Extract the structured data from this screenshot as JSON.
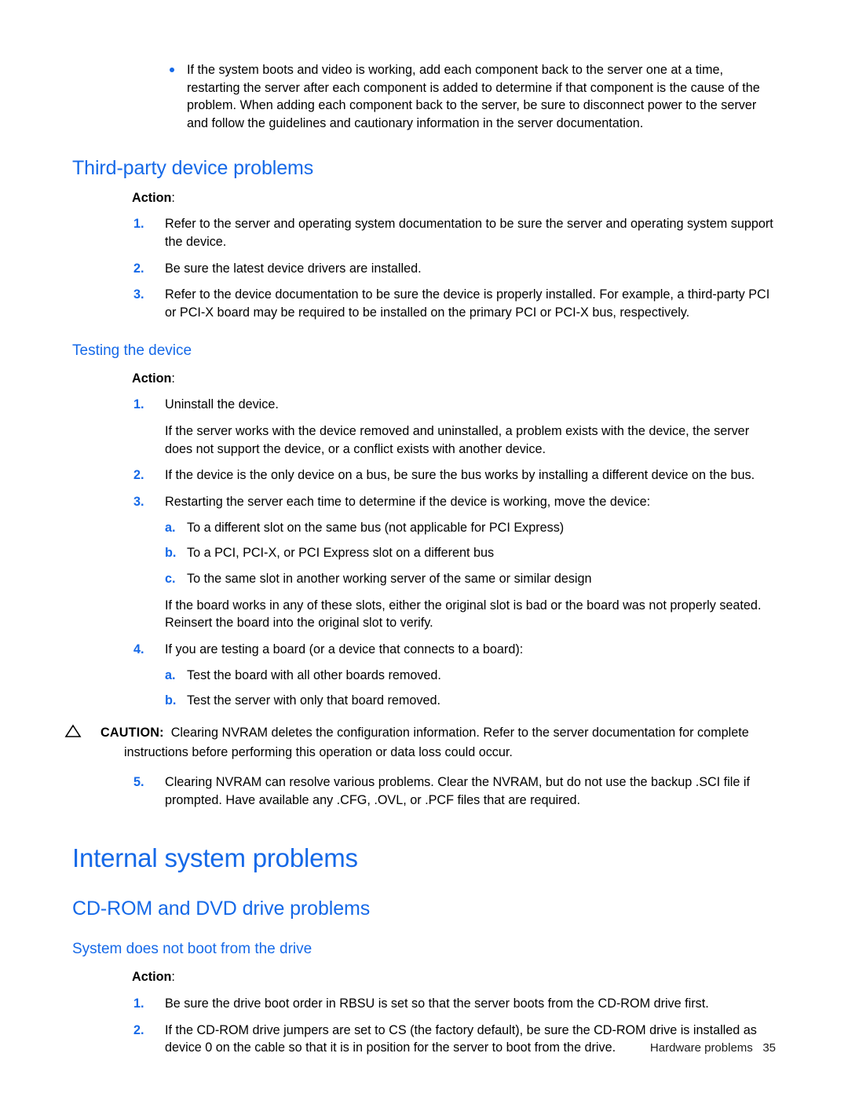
{
  "document": {
    "footer": {
      "chapter": "Hardware problems",
      "page_number": "35"
    }
  },
  "top_bullet": {
    "icon": "bullet-dot",
    "text": "If the system boots and video is working, add each component back to the server one at a time, restarting the server after each component is added to determine if that component is the cause of the problem. When adding each component back to the server, be sure to disconnect power to the server and follow the guidelines and cautionary information in the server documentation."
  },
  "sections": {
    "third_party": {
      "heading": "Third-party device problems",
      "action_label": "Action",
      "action_colon": ":",
      "steps": [
        {
          "marker": "1.",
          "text": "Refer to the server and operating system documentation to be sure the server and operating system support the device."
        },
        {
          "marker": "2.",
          "text": "Be sure the latest device drivers are installed."
        },
        {
          "marker": "3.",
          "text": "Refer to the device documentation to be sure the device is properly installed. For example, a third-party PCI or PCI-X board may be required to be installed on the primary PCI or PCI-X bus, respectively."
        }
      ]
    },
    "testing_the_device": {
      "heading": "Testing the device",
      "action_label": "Action",
      "action_colon": ":",
      "step1": {
        "marker": "1.",
        "text": "Uninstall the device."
      },
      "step1_note": "If the server works with the device removed and uninstalled, a problem exists with the device, the server does not support the device, or a conflict exists with another device.",
      "step2": {
        "marker": "2.",
        "text": "If the device is the only device on a bus, be sure the bus works by installing a different device on the bus."
      },
      "step3": {
        "marker": "3.",
        "text": "Restarting the server each time to determine if the device is working, move the device:"
      },
      "step3_sub": [
        {
          "marker": "a.",
          "text": "To a different slot on the same bus (not applicable for PCI Express)"
        },
        {
          "marker": "b.",
          "text": "To a PCI, PCI-X, or PCI Express slot on a different bus"
        },
        {
          "marker": "c.",
          "text": "To the same slot in another working server of the same or similar design"
        }
      ],
      "step3_note": "If the board works in any of these slots, either the original slot is bad or the board was not properly seated. Reinsert the board into the original slot to verify.",
      "step4": {
        "marker": "4.",
        "text": "If you are testing a board (or a device that connects to a board):"
      },
      "step4_sub": [
        {
          "marker": "a.",
          "text": "Test the board with all other boards removed."
        },
        {
          "marker": "b.",
          "text": "Test the server with only that board removed."
        }
      ],
      "caution": {
        "icon": "warning-triangle-icon",
        "keyword": "CAUTION:",
        "text": "Clearing NVRAM deletes the configuration information. Refer to the server documentation for complete instructions before performing this operation or data loss could occur."
      },
      "step5": {
        "marker": "5.",
        "text": "Clearing NVRAM can resolve various problems. Clear the NVRAM, but do not use the backup .SCI file if prompted. Have available any .CFG, .OVL, or .PCF files that are required."
      }
    },
    "internal_system_problems": {
      "heading": "Internal system problems",
      "cdrom": {
        "heading": "CD-ROM and DVD drive problems",
        "subheading": "System does not boot from the drive",
        "action_label": "Action",
        "action_colon": ":",
        "steps": [
          {
            "marker": "1.",
            "text": "Be sure the drive boot order in RBSU is set so that the server boots from the CD-ROM drive first."
          },
          {
            "marker": "2.",
            "text": "If the CD-ROM drive jumpers are set to CS (the factory default), be sure the CD-ROM drive is installed as device 0 on the cable so that it is in position for the server to boot from the drive."
          }
        ]
      }
    }
  },
  "colors": {
    "heading_blue": "#1569e8",
    "body_black": "#000000"
  }
}
